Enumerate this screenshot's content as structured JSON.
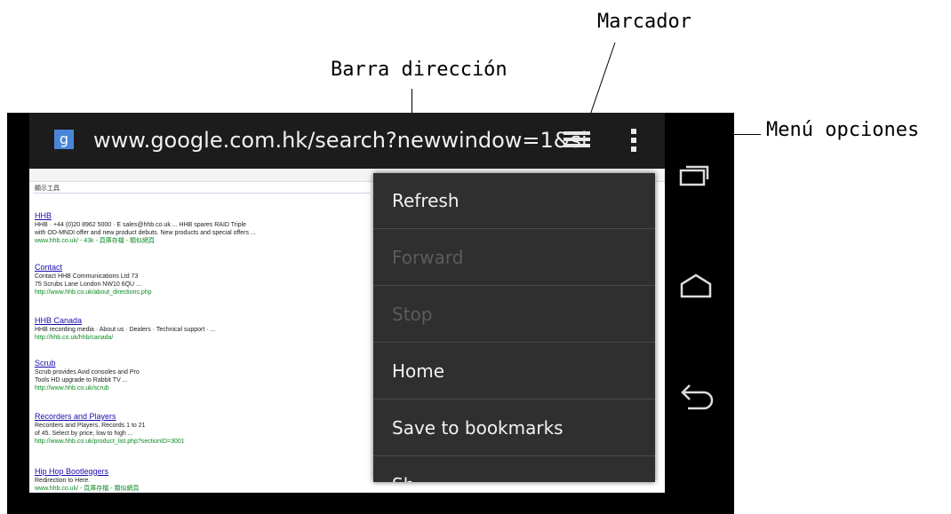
{
  "callouts": {
    "marcador": "Marcador",
    "barra_direccion": "Barra dirección",
    "menu_opciones": "Menú opciones"
  },
  "browser": {
    "favicon": "g",
    "url": "www.google.com.hk/search?newwindow=1&si",
    "icons": [
      "bookmark-list-icon",
      "overflow-menu-icon"
    ]
  },
  "overflow_menu": {
    "items": [
      {
        "label": "Refresh",
        "enabled": true
      },
      {
        "label": "Forward",
        "enabled": false
      },
      {
        "label": "Stop",
        "enabled": false
      },
      {
        "label": "Home",
        "enabled": true
      },
      {
        "label": "Save to bookmarks",
        "enabled": true
      },
      {
        "label": "Sh",
        "enabled": true
      }
    ]
  },
  "webpage": {
    "tools_label": "顯示工具",
    "results": [
      {
        "title": "HHB",
        "snippet1": "HHB · +44 (0)20 8962 5000 · E sales@hhb.co.uk ... HHB spares RAID Triple",
        "snippet2": "with OD-MNDI offer and new product debuts. New products and special offers ...",
        "url": "www.hhb.co.uk/ - 43k - 頁庫存檔 - 類似網頁"
      },
      {
        "title": "Contact",
        "snippet1": "Contact HHB Communications Ltd 73",
        "snippet2": "75 Scrubs Lane London NW10 6QU ...",
        "url": "http://www.hhb.co.uk/about_directions.php"
      },
      {
        "title": "HHB Canada",
        "snippet1": "HHB recording media · About us · Dealers · Technical support · ...",
        "snippet2": "",
        "url": "http://hhb.co.uk/hhb/canada/"
      },
      {
        "title": "Scrub",
        "snippet1": "Scrub provides Avid consoles and Pro",
        "snippet2": "Tools HD upgrade to Rabbit TV ...",
        "url": "http://www.hhb.co.uk/scrub"
      },
      {
        "title": "Recorders and Players",
        "snippet1": "Recorders and Players. Records 1 to 21",
        "snippet2": "of 45. Select by price, low to high ...",
        "url": "http://www.hhb.co.uk/product_list.php?sectionID=3001"
      },
      {
        "title": "Hip Hop Bootleggers",
        "snippet1": "Redirection to Here.",
        "snippet2": "",
        "url": "www.hhb.co.uk/ - 頁庫存檔 - 類似網頁"
      }
    ]
  },
  "system_nav": {
    "buttons": [
      "recent-apps-icon",
      "home-icon",
      "back-icon"
    ]
  },
  "colors": {
    "toolbar": "#1c1c1c",
    "menu_bg": "#2f2f2f",
    "menu_text": "#f2f2f2",
    "menu_disabled": "#5c5c5c",
    "link": "#1a0dab",
    "result_url": "#0a8a24",
    "favicon": "#4a86d8"
  }
}
